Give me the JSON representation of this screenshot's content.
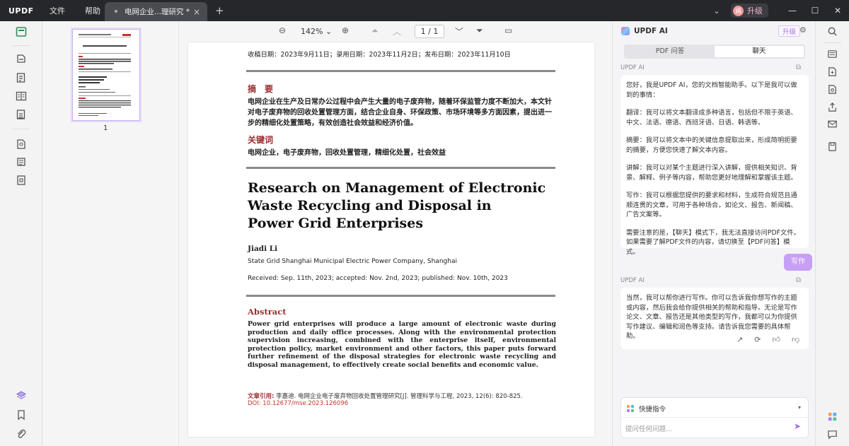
{
  "app": {
    "logo": "UPDF"
  },
  "menu": {
    "file": "文件",
    "help": "帮助"
  },
  "tab": {
    "title": "电网企业...理研究 *",
    "close": "×",
    "new": "+"
  },
  "account": {
    "avatar": "嫣",
    "upgrade": "升级"
  },
  "window": {
    "chevron": "⌄",
    "minimize": "—",
    "maximize": "☐",
    "close": "✕"
  },
  "thumbnails": {
    "page_number": "1"
  },
  "toolbar": {
    "zoom": "142%",
    "zoom_caret": "⌄",
    "page": "1 / 1"
  },
  "page": {
    "dates": "收稿日期：2023年9月11日；录用日期：2023年11月2日；发布日期：2023年11月10日",
    "abstract_cn_head": "摘　要",
    "abstract_cn": "电网企业在生产及日常办公过程中会产生大量的电子废弃物，随着环保监管力度不断加大，本文针对电子废弃物的回收处置管理方面，结合企业自身、环保政策、市场环境等多方面因素，提出进一步的精细化处置策略，有效创造社会效益和经济价值。",
    "keywords_head": "关键词",
    "keywords": "电网企业，电子废弃物，回收处置管理，精细化处置，社会效益",
    "en_title_1": "Research on Management of Electronic",
    "en_title_2": "Waste Recycling and Disposal in",
    "en_title_3": "Power Grid Enterprises",
    "author": "Jiadi Li",
    "affiliation": "State Grid Shanghai Municipal Electric Power Company, Shanghai",
    "received": "Received: Sep. 11th, 2023; accepted: Nov. 2nd, 2023; published: Nov. 10th, 2023",
    "abstract_en_head": "Abstract",
    "abstract_en": "Power grid enterprises will produce a large amount of electronic waste during production and daily office processes. Along with the environmental protection supervision increasing, combined with the enterprise itself, environmental protection policy, market environment and other factors, this paper puts forward further refinement of the disposal strategies for electronic waste recycling and disposal management, to effectively create social benefits and economic value.",
    "cite_label": "文章引用:",
    "cite_text": " 李嘉迪. 电网企业电子废弃物回收处置管理研究[J]. 管理科学与工程, 2023, 12(6): 820-825.",
    "doi": "DOI: 10.12677/mse.2023.126096"
  },
  "ai": {
    "title": "UPDF AI",
    "upgrade": "升级",
    "tabs": [
      "PDF 问答",
      "聊天"
    ],
    "sender": "UPDF AI",
    "msg1": [
      "您好，我是UPDF AI，您的文档智能助手。以下是我可以做到的事情：",
      "翻译：我可以将文本翻译成多种语言，包括但不限于英语、中文、法语、德语、西班牙语、日语、韩语等。",
      "摘要：我可以将文本中的关键信息提取出来，形成简明扼要的摘要，方便您快速了解文本内容。",
      "讲解：我可以对某个主题进行深入讲解，提供相关知识、背景、解释、例子等内容，帮助您更好地理解和掌握该主题。",
      "写作：我可以根据您提供的要求和材料，生成符合规范且通顺连贯的文章，可用于各种场合，如论文、报告、新闻稿、广告文案等。",
      "需要注意的是，【聊天】模式下，我无法直接访问PDF文件。如果需要了解PDF文件的内容，请切换至【PDF问答】模式。"
    ],
    "user_msg": "写作",
    "msg2": "当然，我可以帮你进行写作。你可以告诉我你想写作的主题或内容，然后我会给你提供相关的帮助和指导。无论是写作论文、文章、报告还是其他类型的写作，我都可以为你提供写作建议、编辑和润色等支持。请告诉我您需要的具体帮助。",
    "quick_cmd": "快捷指令",
    "input_placeholder": "提问任何问题..."
  },
  "colors": {
    "accent": "#a76ee6",
    "heading_red": "#9b2f2f",
    "titlebar": "#26272b"
  }
}
